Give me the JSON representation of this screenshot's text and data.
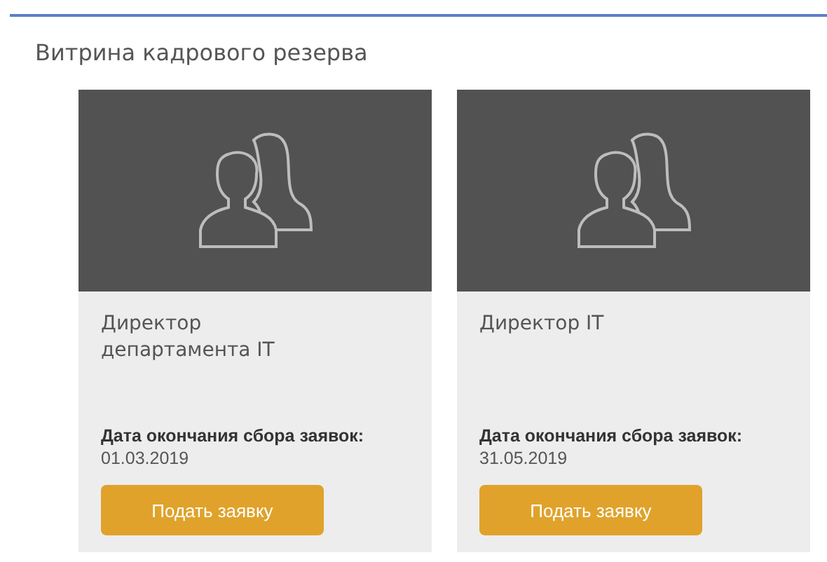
{
  "page": {
    "title": "Витрина кадрового резерва"
  },
  "cards": [
    {
      "title": "Директор\nдепартамента IT",
      "deadline_label": "Дата окончания сбора заявок:",
      "deadline": "01.03.2019",
      "button": "Подать заявку"
    },
    {
      "title": "Директор IT",
      "deadline_label": "Дата окончания сбора заявок:",
      "deadline": "31.05.2019",
      "button": "Подать заявку"
    }
  ]
}
